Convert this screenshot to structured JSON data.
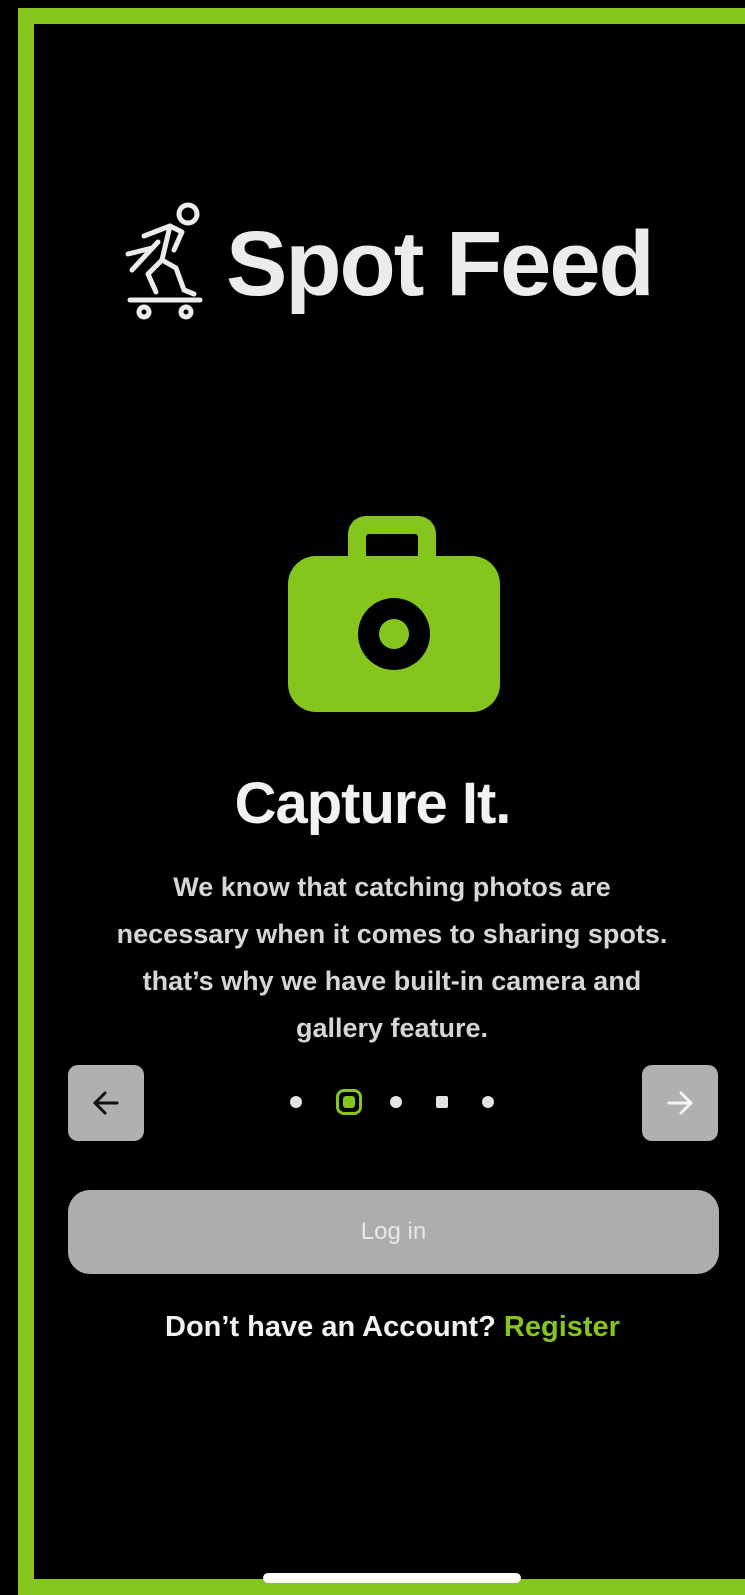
{
  "brand": {
    "name": "Spot Feed",
    "logo_icon": "skateboarder-icon"
  },
  "onboarding": {
    "icon": "camera-icon",
    "title": "Capture It.",
    "description_lines": [
      "We know that catching photos are",
      "necessary when it comes to sharing spots.",
      "that’s why we have built-in camera and",
      "gallery feature."
    ],
    "prev_icon": "arrow-left-icon",
    "next_icon": "arrow-right-icon",
    "pagination": {
      "total": 5,
      "active_index": 1
    }
  },
  "actions": {
    "login_label": "Log in",
    "register_prompt": "Don’t have an Account?",
    "register_link": "Register"
  },
  "colors": {
    "accent": "#84c51e",
    "background": "#000000",
    "button_gray": "#adadad"
  }
}
